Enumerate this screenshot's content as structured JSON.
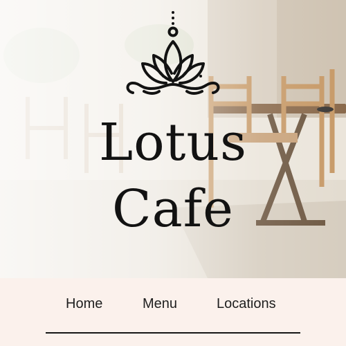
{
  "brand": {
    "name_line1": "Lotus",
    "name_line2": "Cafe",
    "logo_icon": "lotus-flower-icon"
  },
  "nav": {
    "items": [
      {
        "label": "Home"
      },
      {
        "label": "Menu"
      },
      {
        "label": "Locations"
      }
    ]
  },
  "colors": {
    "nav_background": "#fbf1ec",
    "text": "#121212",
    "underline": "#151515"
  }
}
